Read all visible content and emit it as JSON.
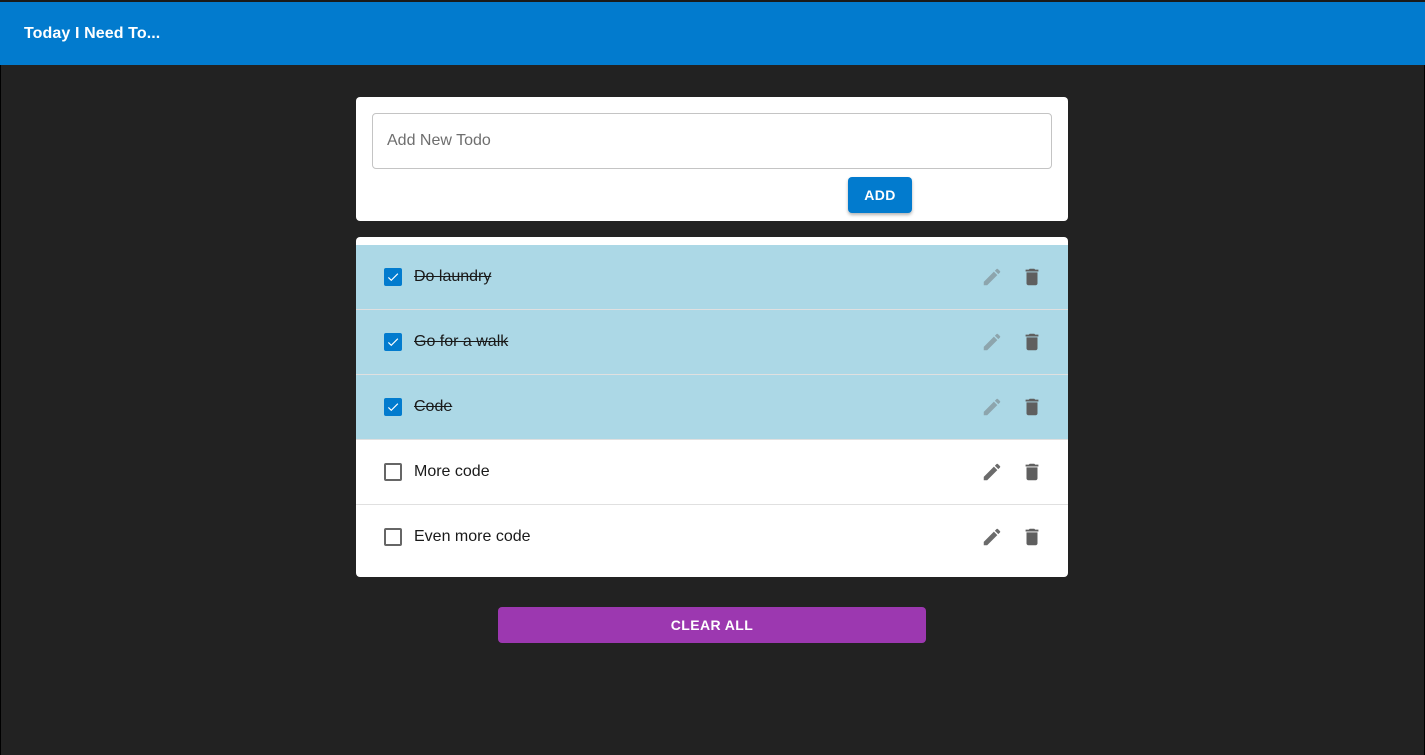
{
  "appbar": {
    "title": "Today I Need To..."
  },
  "add_form": {
    "placeholder": "Add New Todo",
    "value": "",
    "add_label": "ADD"
  },
  "todos": [
    {
      "text": "Do laundry",
      "completed": true
    },
    {
      "text": "Go for a walk",
      "completed": true
    },
    {
      "text": "Code",
      "completed": true
    },
    {
      "text": "More code",
      "completed": false
    },
    {
      "text": "Even more code",
      "completed": false
    }
  ],
  "actions": {
    "clear_all_label": "CLEAR ALL"
  },
  "icons": {
    "edit": "pencil-icon",
    "delete": "trash-icon",
    "check": "checkmark-icon"
  },
  "colors": {
    "primary": "#027bce",
    "completed_row": "#acd8e6",
    "clear_button": "#9c38b0",
    "background": "#222222"
  }
}
